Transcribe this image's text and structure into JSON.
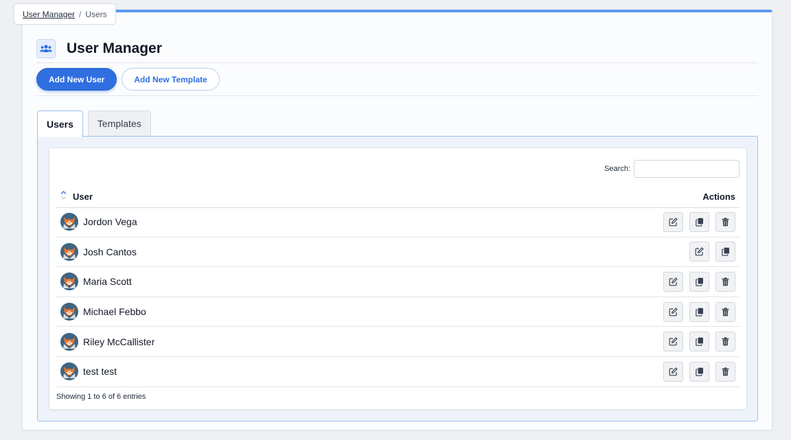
{
  "breadcrumb": {
    "parent": "User Manager",
    "current": "Users",
    "separator": "/"
  },
  "page": {
    "title": "User Manager"
  },
  "buttons": {
    "add_user": "Add New User",
    "add_template": "Add New Template"
  },
  "tabs": [
    {
      "label": "Users",
      "active": true
    },
    {
      "label": "Templates",
      "active": false
    }
  ],
  "table": {
    "search_label": "Search:",
    "search_value": "",
    "columns": {
      "user": "User",
      "actions": "Actions"
    },
    "rows": [
      {
        "name": "Jordon Vega",
        "actions": [
          "edit",
          "copy",
          "delete"
        ]
      },
      {
        "name": "Josh Cantos",
        "actions": [
          "edit",
          "copy"
        ]
      },
      {
        "name": "Maria Scott",
        "actions": [
          "edit",
          "copy",
          "delete"
        ]
      },
      {
        "name": "Michael Febbo",
        "actions": [
          "edit",
          "copy",
          "delete"
        ]
      },
      {
        "name": "Riley McCallister",
        "actions": [
          "edit",
          "copy",
          "delete"
        ]
      },
      {
        "name": "test test",
        "actions": [
          "edit",
          "copy",
          "delete"
        ]
      }
    ],
    "info": "Showing 1 to 6 of 6 entries"
  },
  "colors": {
    "accent": "#2f6fe0",
    "top_border": "#5b9bf0",
    "avatar_bg": "#3e6582",
    "fox": "#e8732c"
  }
}
